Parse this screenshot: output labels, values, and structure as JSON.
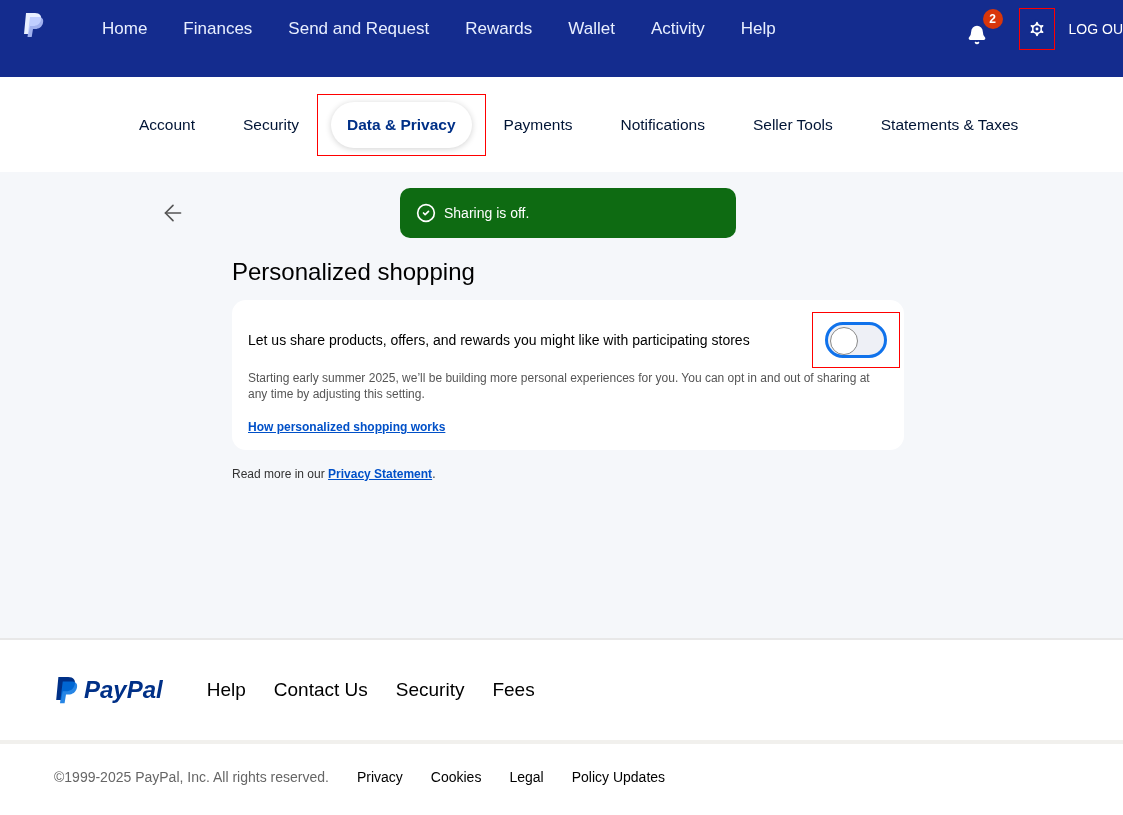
{
  "top_nav": {
    "items": [
      {
        "label": "Home"
      },
      {
        "label": "Finances"
      },
      {
        "label": "Send and Request"
      },
      {
        "label": "Rewards"
      },
      {
        "label": "Wallet"
      },
      {
        "label": "Activity"
      },
      {
        "label": "Help"
      }
    ],
    "notification_count": "2",
    "settings_highlighted": true,
    "logout": "LOG OU"
  },
  "tabs": [
    {
      "label": "Account",
      "selected": false,
      "highlighted": false
    },
    {
      "label": "Security",
      "selected": false,
      "highlighted": false
    },
    {
      "label": "Data & Privacy",
      "selected": true,
      "highlighted": true
    },
    {
      "label": "Payments",
      "selected": false,
      "highlighted": false
    },
    {
      "label": "Notifications",
      "selected": false,
      "highlighted": false
    },
    {
      "label": "Seller Tools",
      "selected": false,
      "highlighted": false
    },
    {
      "label": "Statements & Taxes",
      "selected": false,
      "highlighted": false
    }
  ],
  "toast": {
    "message": "Sharing is off."
  },
  "section": {
    "title": "Personalized shopping",
    "setting": {
      "label": "Let us share products, offers, and rewards you might like with participating stores",
      "on": false,
      "highlighted": true,
      "description": "Starting early summer 2025, we’ll be building more personal experiences for you. You can opt in and out of sharing at any time by adjusting this setting.",
      "link": "How personalized shopping works"
    },
    "read_more": {
      "before": "Read more in our",
      "link": "Privacy Statement",
      "after": "."
    }
  },
  "footer": {
    "logo_text": "PayPal",
    "links": [
      "Help",
      "Contact Us",
      "Security",
      "Fees"
    ],
    "copyright": "©1999-2025 PayPal, Inc. All rights reserved.",
    "legal_links": [
      "Privacy",
      "Cookies",
      "Legal",
      "Policy Updates"
    ]
  }
}
